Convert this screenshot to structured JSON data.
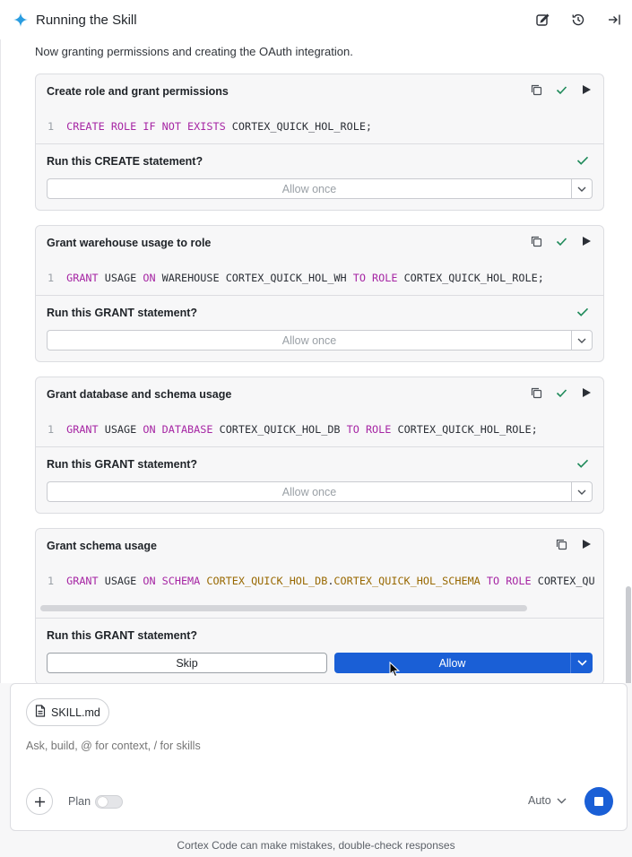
{
  "header": {
    "title": "Running the Skill",
    "icons": [
      "sparkle-icon",
      "edit-icon",
      "history-icon",
      "collapse-panel-icon"
    ]
  },
  "intro": "Now granting permissions and creating the OAuth integration.",
  "cards": [
    {
      "title": "Create role and grant permissions",
      "line_no": "1",
      "code": [
        {
          "t": "CREATE ROLE IF NOT EXISTS",
          "c": "kw"
        },
        {
          "t": " CORTEX_QUICK_HOL_ROLE;",
          "c": "id"
        }
      ],
      "question": "Run this CREATE statement?",
      "allow_label": "Allow once",
      "done": true
    },
    {
      "title": "Grant warehouse usage to role",
      "line_no": "1",
      "code": [
        {
          "t": "GRANT",
          "c": "kw"
        },
        {
          "t": " USAGE ",
          "c": "id"
        },
        {
          "t": "ON",
          "c": "kw"
        },
        {
          "t": " WAREHOUSE CORTEX_QUICK_HOL_WH ",
          "c": "id"
        },
        {
          "t": "TO ROLE",
          "c": "kw"
        },
        {
          "t": " CORTEX_QUICK_HOL_ROLE;",
          "c": "id"
        }
      ],
      "question": "Run this GRANT statement?",
      "allow_label": "Allow once",
      "done": true
    },
    {
      "title": "Grant database and schema usage",
      "line_no": "1",
      "code": [
        {
          "t": "GRANT",
          "c": "kw"
        },
        {
          "t": " USAGE ",
          "c": "id"
        },
        {
          "t": "ON DATABASE",
          "c": "kw"
        },
        {
          "t": " CORTEX_QUICK_HOL_DB ",
          "c": "id"
        },
        {
          "t": "TO ROLE",
          "c": "kw"
        },
        {
          "t": " CORTEX_QUICK_HOL_ROLE;",
          "c": "id"
        }
      ],
      "question": "Run this GRANT statement?",
      "allow_label": "Allow once",
      "done": true
    },
    {
      "title": "Grant schema usage",
      "line_no": "1",
      "code": [
        {
          "t": "GRANT",
          "c": "kw"
        },
        {
          "t": " USAGE ",
          "c": "id"
        },
        {
          "t": "ON SCHEMA",
          "c": "kw"
        },
        {
          "t": " CORTEX_QUICK_HOL_DB",
          "c": "id2"
        },
        {
          "t": ".",
          "c": "id"
        },
        {
          "t": "CORTEX_QUICK_HOL_SCHEMA",
          "c": "id2"
        },
        {
          "t": " ",
          "c": "id"
        },
        {
          "t": "TO ROLE",
          "c": "kw"
        },
        {
          "t": " CORTEX_QU",
          "c": "id"
        }
      ],
      "question": "Run this GRANT statement?",
      "skip_label": "Skip",
      "allow_label": "Allow",
      "done": false
    }
  ],
  "composer": {
    "attachment": "SKILL.md",
    "placeholder": "Ask, build, @ for context, / for skills",
    "plan_label": "Plan",
    "plan_enabled": false,
    "mode_label": "Auto"
  },
  "footer": "Cortex Code can make mistakes, double-check responses",
  "colors": {
    "accent": "#1a5fd6",
    "check": "#1f8a5a",
    "keyword": "#a626a4",
    "identifier_highlight": "#986801"
  }
}
